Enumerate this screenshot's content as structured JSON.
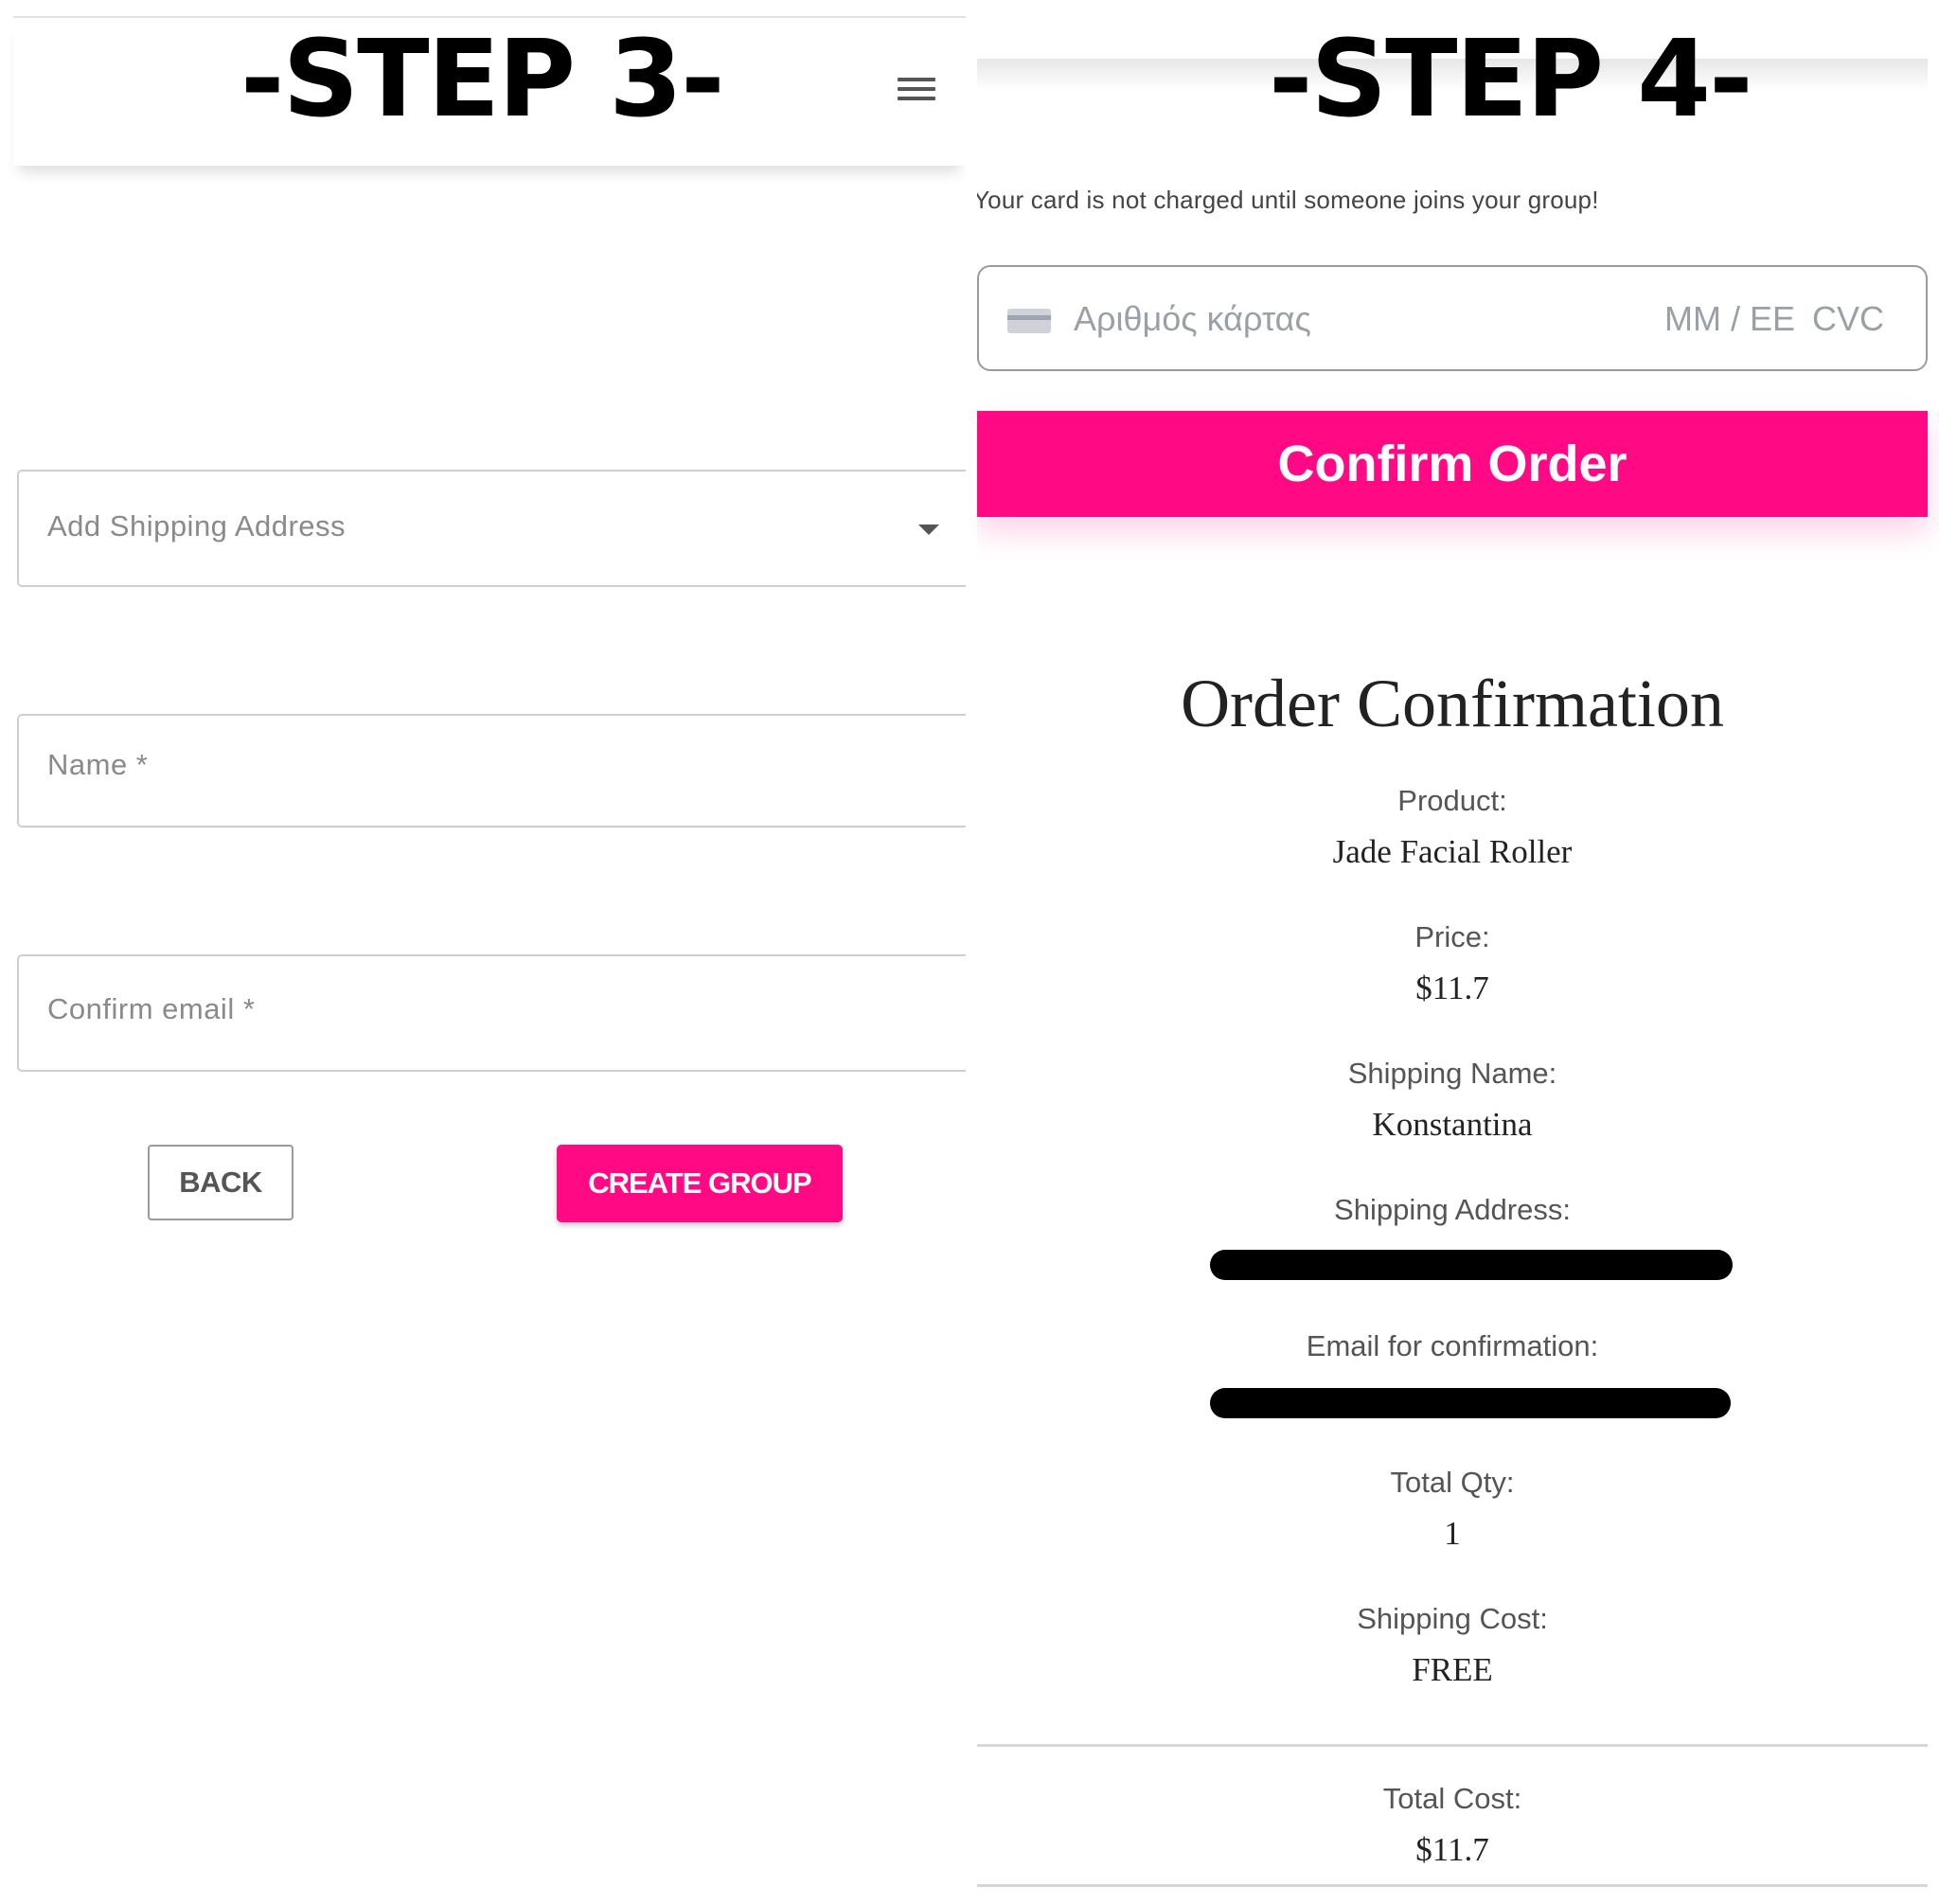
{
  "step3": {
    "title": "-STEP 3-",
    "menu_icon": "hamburger-menu-icon",
    "address_placeholder": "Add Shipping Address",
    "name_placeholder": "Name *",
    "email_placeholder": "Confirm email *",
    "back_label": "BACK",
    "create_label": "CREATE GROUP"
  },
  "step4": {
    "title": "-STEP 4-",
    "notice": "Your card is not charged until someone joins your group!",
    "card": {
      "number_placeholder": "Αριθμός κάρτας",
      "expiry_placeholder": "MM / EE",
      "cvc_placeholder": "CVC"
    },
    "confirm_label": "Confirm Order",
    "order": {
      "title": "Order Confirmation",
      "product_label": "Product:",
      "product_value": "Jade Facial Roller",
      "price_label": "Price:",
      "price_value": "$11.7",
      "shipping_name_label": "Shipping Name:",
      "shipping_name_value": "Konstantina",
      "shipping_address_label": "Shipping Address:",
      "email_label": "Email for confirmation:",
      "qty_label": "Total Qty:",
      "qty_value": "1",
      "shipping_cost_label": "Shipping Cost:",
      "shipping_cost_value": "FREE",
      "total_label": "Total Cost:",
      "total_value": "$11.7"
    }
  },
  "colors": {
    "accent": "#ff0a84",
    "border": "#cfcfcf",
    "text": "#333333"
  }
}
